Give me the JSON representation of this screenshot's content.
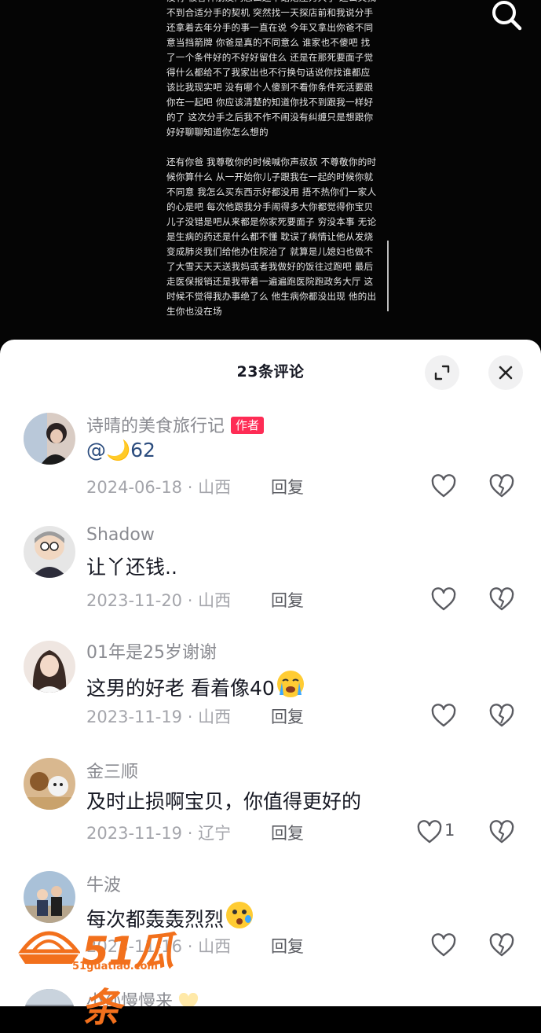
{
  "video": {
    "post_paragraphs": [
      "没有 被各种朋友问怎么还不结婚压力大了 还公又找不到合适分手的契机 突然找一天探店前和我说分手 还拿着去年分手的事一直在说 今年又拿出你爸不同意当挡箭牌 你爸是真的不同意么 谁家也不傻吧 找了一个条件好的不好好留住么 还是在那死要面子觉得什么都给不了我家出也不行换句话说你找谁都应该比我现实吧 没有哪个人傻到不看你条件死活要跟你在一起吧 你应该清楚的知道你找不到跟我一样好的了 这次分手之后我不作不闹没有纠缠只是想跟你好好聊聊知道你怎么想的",
      "还有你爸 我尊敬你的时候喊你声叔叔 不尊敬你的时候你算什么 从一开始你儿子跟我在一起的时候你就不同意 我怎么买东西示好都没用 捂不热你们一家人的心是吧 每次他跟我分手闹得多大你都觉得你宝贝儿子没错是吧从来都是你家死要面子 穷没本事 无论是生病的药还是什么都不懂 耽误了病情让他从发烧变成肺炎我们给他办住院治了 就算是儿媳妇也做不了大雪天天天送我妈或者我做好的饭往过跑吧 最后走医保报销还是我带着一遍遍跑医院跑政务大厅 这时候不觉得我办事绝了么 他生病你都没出现 他的出生你也没在场"
    ],
    "search_icon": "search-icon"
  },
  "sheet": {
    "title": "23条评论",
    "expand_icon": "expand-icon",
    "close_icon": "close-icon"
  },
  "comments": [
    {
      "name": "诗晴的美食旅行记",
      "badge": "作者",
      "text_prefix": "@",
      "text_emoji": "🌙",
      "text_suffix": "62",
      "date": "2024-06-18",
      "location": "山西",
      "reply": "回复",
      "likes": ""
    },
    {
      "name": "Shadow",
      "text": "让丫还钱..",
      "date": "2023-11-20",
      "location": "山西",
      "reply": "回复",
      "likes": ""
    },
    {
      "name": "01年是25岁谢谢",
      "text": "这男的好老 看着像40",
      "date": "2023-11-19",
      "location": "山西",
      "reply": "回复",
      "likes": ""
    },
    {
      "name": "金三顺",
      "text": "及时止损啊宝贝，你值得更好的",
      "date": "2023-11-19",
      "location": "辽宁",
      "reply": "回复",
      "likes": "1"
    },
    {
      "name": "牛波",
      "text": "每次都轰轰烈烈",
      "date": "2023-11-16",
      "location": "山西",
      "reply": "回复",
      "likes": ""
    },
    {
      "name": "小孙慢慢来"
    }
  ],
  "separator": "·",
  "watermark": {
    "brand": "51瓜条",
    "url": "51guatiao.com"
  },
  "colors": {
    "accent": "#fe2c55",
    "watermark": "#f2701c",
    "mention": "#2b4c7e"
  }
}
